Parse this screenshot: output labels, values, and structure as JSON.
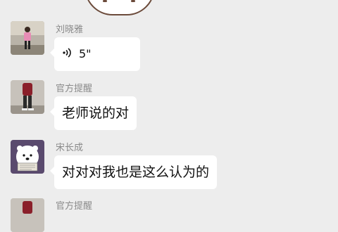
{
  "messages": [
    {
      "sender": "刘晓雅",
      "type": "voice",
      "duration": "5\"",
      "avatar": "person-pink-coat-avatar"
    },
    {
      "sender": "官方提醒",
      "type": "text",
      "text": "老师说的对",
      "avatar": "person-red-jacket-avatar"
    },
    {
      "sender": "宋长成",
      "type": "text",
      "text": "对对对我也是这么认为的",
      "avatar": "polar-bear-avatar"
    },
    {
      "sender": "官方提醒",
      "type": "text",
      "text": "",
      "avatar": "person-red-jacket-avatar"
    }
  ],
  "colors": {
    "background": "#ededed",
    "bubble": "#ffffff",
    "sender_text": "#8a8a8a",
    "message_text": "#111111"
  }
}
